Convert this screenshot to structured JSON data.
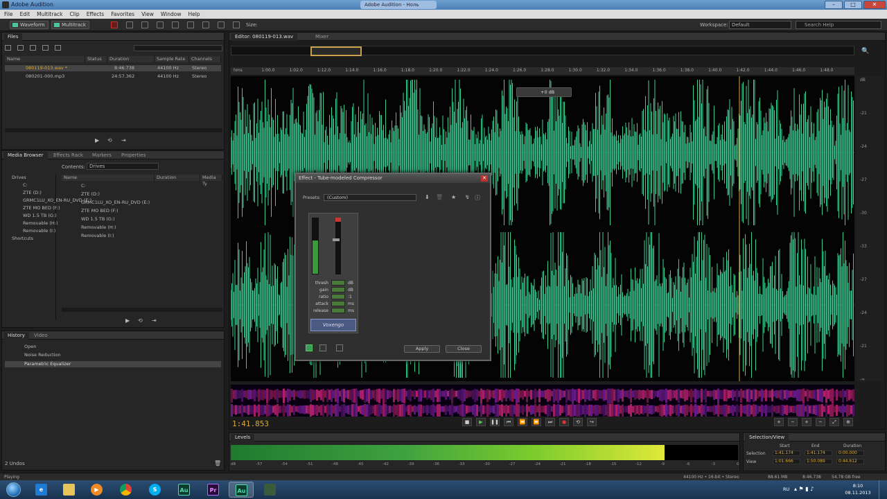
{
  "window": {
    "title": "Adobe Audition",
    "taskbar_tab": "Adobe Audition - Ноль"
  },
  "menu": [
    "File",
    "Edit",
    "Multitrack",
    "Clip",
    "Effects",
    "Favorites",
    "View",
    "Window",
    "Help"
  ],
  "toolbar": {
    "waveform": "Waveform",
    "multitrack": "Multitrack",
    "size_label": "Size:",
    "workspace_label": "Workspace:",
    "workspace_value": "Default",
    "search_placeholder": "Search Help"
  },
  "files_panel": {
    "tab": "Files",
    "columns": [
      "Name",
      "Status",
      "Duration",
      "Sample Rate",
      "Channels"
    ],
    "rows": [
      {
        "name": "080119-013.wav *",
        "duration": "8:46.738",
        "rate": "44100 Hz",
        "channels": "Stereo"
      },
      {
        "name": "080201-000.mp3",
        "duration": "24:57.362",
        "rate": "44100 Hz",
        "channels": "Stereo"
      }
    ]
  },
  "media_panel": {
    "tabs": [
      "Media Browser",
      "Effects Rack",
      "Markers",
      "Properties"
    ],
    "contents_label": "Contents:",
    "contents_value": "Drives",
    "tree": [
      "Drives",
      "C:",
      "ZTE (D:)",
      "GRMC1LU_XO_EN-RU_DVD (E:)",
      "ZTE MO BED (F:)",
      "WD 1.5 TB (G:)",
      "Removable (H:)",
      "Removable (I:)",
      "Shortcuts"
    ],
    "columns": [
      "Name",
      "Duration",
      "Media Ty"
    ],
    "list": [
      "C:",
      "ZTE (D:)",
      "GRMC1LU_XO_EN-RU_DVD (E:)",
      "ZTE MO BED (F:)",
      "WD 1.5 TB (G:)",
      "Removable (H:)",
      "Removable (I:)"
    ]
  },
  "history_panel": {
    "tabs": [
      "History",
      "Video"
    ],
    "items": [
      "Open",
      "Noise Reduction",
      "Parametric Equalizer"
    ],
    "undos": "2 Undos"
  },
  "editor": {
    "tab": "Editor: 080119-013.wav",
    "mixer_tab": "Mixer",
    "ruler": [
      "hms",
      "1:00.0",
      "1:02.0",
      "1:12.0",
      "1:14.0",
      "1:16.0",
      "1:18.0",
      "1:20.0",
      "1:22.0",
      "1:24.0",
      "1:26.0",
      "1:28.0",
      "1:30.0",
      "1:32.0",
      "1:34.0",
      "1:36.0",
      "1:38.0",
      "1:40.0",
      "1:42.0",
      "1:44.0",
      "1:46.0",
      "1:48.0"
    ],
    "db_scale": [
      "dB",
      "-21",
      "-24",
      "-27",
      "-30",
      "-33",
      "-27",
      "-24",
      "-21",
      "-∞"
    ],
    "hud": "+0 dB",
    "timecode": "1:41.853",
    "waveform_color": "#3fcf95"
  },
  "dialog": {
    "title": "Effect - Tube-modeled Compressor",
    "presets_label": "Presets:",
    "presets_value": "(Custom)",
    "params": [
      {
        "k": "thresh",
        "v": "dB"
      },
      {
        "k": "gain",
        "v": "dB"
      },
      {
        "k": "ratio",
        "v": ":1"
      },
      {
        "k": "attack",
        "v": "ms"
      },
      {
        "k": "release",
        "v": "ms"
      }
    ],
    "plugin_brand": "Voxengo",
    "apply": "Apply",
    "close": "Close"
  },
  "levels": {
    "tab": "Levels",
    "fill": 0.855,
    "scale": [
      "dB",
      "-57",
      "-54",
      "-51",
      "-48",
      "-45",
      "-42",
      "-39",
      "-36",
      "-33",
      "-30",
      "-27",
      "-24",
      "-21",
      "-18",
      "-15",
      "-12",
      "-9",
      "-6",
      "-3",
      "0"
    ]
  },
  "selection_view": {
    "tab": "Selection/View",
    "headers": [
      "Start",
      "End",
      "Duration"
    ],
    "rows": [
      {
        "label": "Selection",
        "start": "1:41.174",
        "end": "1:41.174",
        "dur": "0:00.000"
      },
      {
        "label": "View",
        "start": "1:01.666",
        "end": "1:50.089",
        "dur": "0:44.612"
      }
    ]
  },
  "status": {
    "left": "Playing",
    "rate": "44100 Hz • 16-bit • Stereo",
    "size": "88.61 MB",
    "dur": "8:46.738",
    "free": "54.78 GB free"
  },
  "taskbar": {
    "time": "8:10",
    "date": "08.11.2013",
    "lang": "RU"
  }
}
